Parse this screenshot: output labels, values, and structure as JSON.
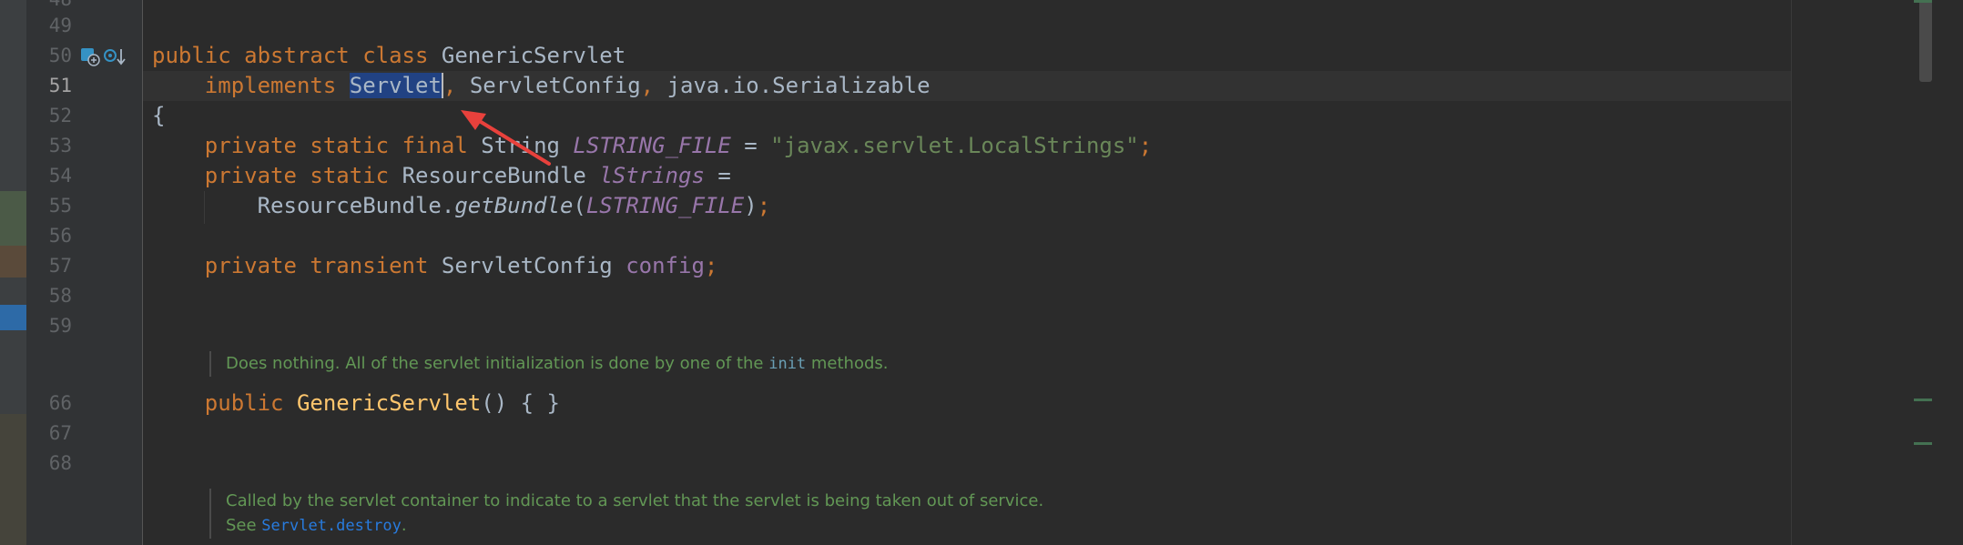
{
  "gutter": {
    "line_numbers": [
      "49",
      "50",
      "51",
      "52",
      "53",
      "54",
      "55",
      "56",
      "57",
      "58",
      "59",
      "66",
      "67",
      "68"
    ]
  },
  "code": {
    "line50": {
      "kw1": "public",
      "kw2": "abstract",
      "kw3": "class",
      "name": "GenericServlet"
    },
    "line51": {
      "kw": "implements",
      "selected": "Servlet",
      "comma1": ",",
      "iface2": "ServletConfig",
      "comma2": ",",
      "iface3": "java.io.Serializable"
    },
    "line52": {
      "brace": "{"
    },
    "line53": {
      "kw1": "private",
      "kw2": "static",
      "kw3": "final",
      "type": "String",
      "const": "LSTRING_FILE",
      "eq": "=",
      "str": "\"javax.servlet.LocalStrings\"",
      "semi": ";"
    },
    "line54": {
      "kw1": "private",
      "kw2": "static",
      "type": "ResourceBundle",
      "field": "lStrings",
      "eq": "="
    },
    "line55": {
      "cls": "ResourceBundle.",
      "method": "getBundle",
      "paren_open": "(",
      "const": "LSTRING_FILE",
      "paren_close": ")",
      "semi": ";"
    },
    "line57": {
      "kw1": "private",
      "kw2": "transient",
      "type": "ServletConfig",
      "field": "config",
      "semi": ";"
    },
    "line66": {
      "kw": "public",
      "method": "GenericServlet",
      "rest": "() { }"
    }
  },
  "docs": {
    "doc1": {
      "text_before": "Does nothing. All of the servlet initialization is done by one of the ",
      "code": "init",
      "text_after": " methods."
    },
    "doc2": {
      "line1": "Called by the servlet container to indicate to a servlet that the servlet is being taken out of service.",
      "see": "See ",
      "link": "Servlet.destroy",
      "end": "."
    }
  },
  "colors": {
    "background": "#2b2b2b",
    "keyword": "#cc7832",
    "constant": "#9876aa",
    "string": "#6a8759",
    "method_decl": "#ffc66d",
    "doc_comment": "#629755",
    "selection": "#214283",
    "annotation_arrow": "#e8413c"
  },
  "icons": {
    "gutter_implements": "implementing-class-icon",
    "gutter_overrides": "implemented-method-down-icon"
  }
}
